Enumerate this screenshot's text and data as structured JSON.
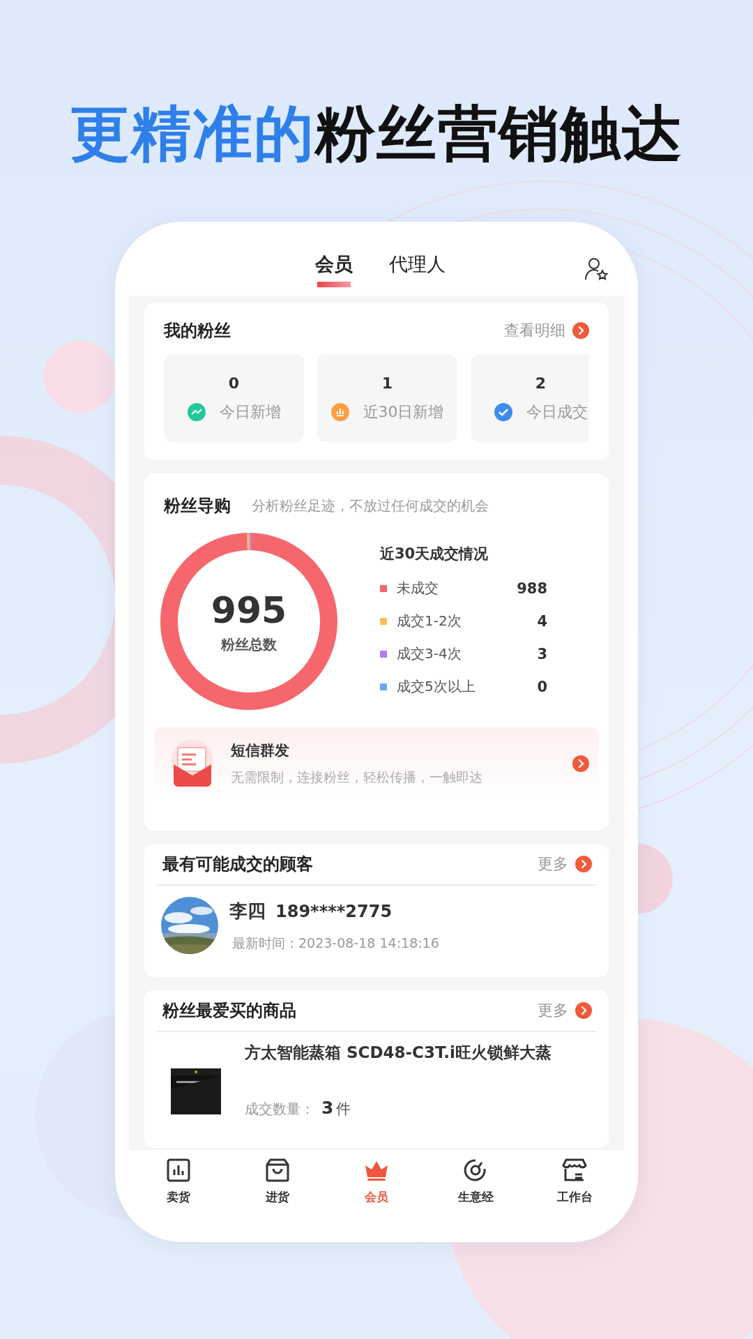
{
  "headline": "**更精准的**粉丝营销触达",
  "tabs": [
    {
      "label": "会员",
      "selected": true
    },
    {
      "label": "代理人",
      "selected": false
    }
  ],
  "my_fans": {
    "title": "我的粉丝",
    "link": "查看明细",
    "stats": [
      {
        "value": "0",
        "label": "今日新增",
        "kind": "trend"
      },
      {
        "value": "1",
        "label": "近30日新增",
        "kind": "bars"
      },
      {
        "value": "2",
        "label": "今日成交",
        "kind": "check"
      }
    ]
  },
  "fan_guide": {
    "title": "粉丝导购",
    "subtitle": "分析粉丝足迹，不放过任何成交的机会",
    "total": "995",
    "total_label": "粉丝总数",
    "legend_title": "近30天成交情况",
    "legend": [
      {
        "value": "988",
        "color": "#f5676c"
      },
      {
        "value": "4",
        "color": "#f9bd57"
      },
      {
        "value": "3",
        "color": "#b27cf3"
      },
      {
        "value": "0",
        "color": "#68a8f5"
      }
    ],
    "chart_data": {
      "type": "donut",
      "categories": [
        "未成交",
        "成交1-2次",
        "成交3-4次",
        "成交5次以上"
      ],
      "values": [
        988,
        4,
        3,
        0
      ]
    },
    "sms": {
      "title": "短信群发",
      "desc": "无需限制，连接粉丝，轻松传播，一触即达"
    }
  },
  "customers": {
    "title": "最有可能成交的顾客",
    "more": "更多",
    "items": [
      {
        "name": "李四",
        "phone": "189****2775",
        "time_label": "最新时间：",
        "time": "2023-08-18 14:18:16"
      }
    ]
  },
  "products": {
    "title": "粉丝最爱买的商品",
    "more": "更多",
    "items": [
      {
        "name": "方太智能蒸箱 SCD48-C3T.i旺火锁鲜大蒸",
        "count_label": "成交数量：",
        "count": "3",
        "unit": "件"
      }
    ]
  },
  "nav": [
    {
      "label": "卖货",
      "kind": "chart",
      "selected": false
    },
    {
      "label": "进货",
      "kind": "bag",
      "selected": false
    },
    {
      "label": "会员",
      "kind": "crown",
      "selected": true
    },
    {
      "label": "生意经",
      "kind": "gauge",
      "selected": false
    },
    {
      "label": "工作台",
      "kind": "store",
      "selected": false
    }
  ]
}
